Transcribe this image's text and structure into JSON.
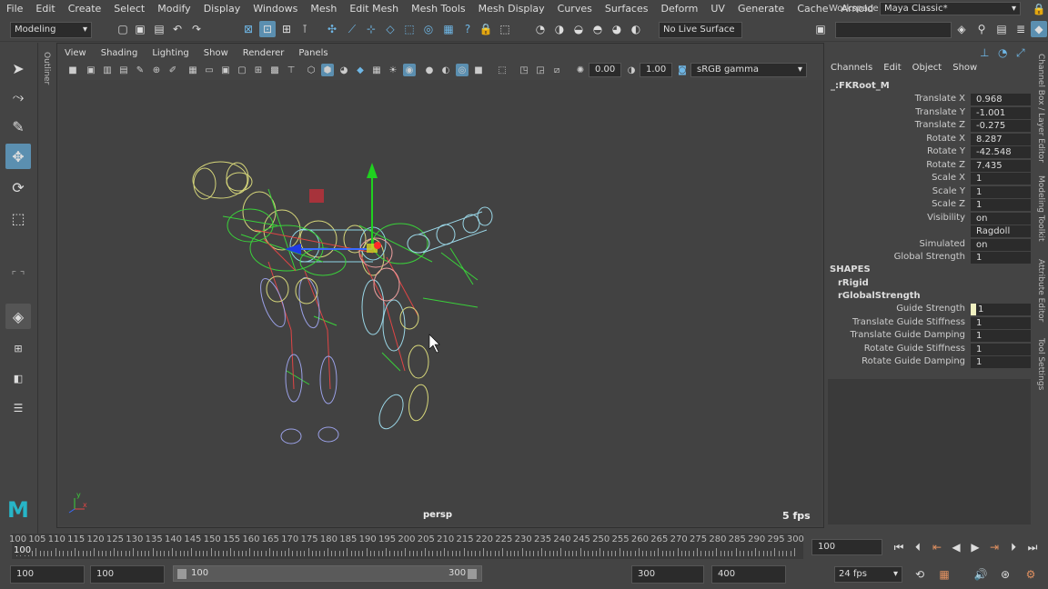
{
  "menu": [
    "File",
    "Edit",
    "Create",
    "Select",
    "Modify",
    "Display",
    "Windows",
    "Mesh",
    "Edit Mesh",
    "Mesh Tools",
    "Mesh Display",
    "Curves",
    "Surfaces",
    "Deform",
    "UV",
    "Generate",
    "Cache",
    "Arnold",
    "Ragdoll"
  ],
  "workspace": {
    "label": "Workspace :",
    "value": "Maya Classic*"
  },
  "shelf": {
    "mode": "Modeling",
    "live_surface": "No Live Surface"
  },
  "outliner_tab": "Outliner",
  "panel_menu": [
    "View",
    "Shading",
    "Lighting",
    "Show",
    "Renderer",
    "Panels"
  ],
  "panel_toolbar": {
    "exposure": "0.00",
    "gamma": "1.00",
    "color_space": "sRGB gamma"
  },
  "viewport": {
    "camera": "persp",
    "fps": "5 fps",
    "axis_x": "x",
    "axis_y": "y"
  },
  "channelbox": {
    "menu": [
      "Channels",
      "Edit",
      "Object",
      "Show"
    ],
    "node": "_:FKRoot_M",
    "attributes": [
      {
        "label": "Translate X",
        "value": "0.968"
      },
      {
        "label": "Translate Y",
        "value": "-1.001"
      },
      {
        "label": "Translate Z",
        "value": "-0.275"
      },
      {
        "label": "Rotate X",
        "value": "8.287"
      },
      {
        "label": "Rotate Y",
        "value": "-42.548"
      },
      {
        "label": "Rotate Z",
        "value": "7.435"
      },
      {
        "label": "Scale X",
        "value": "1"
      },
      {
        "label": "Scale Y",
        "value": "1"
      },
      {
        "label": "Scale Z",
        "value": "1"
      },
      {
        "label": "Visibility",
        "value": "on"
      },
      {
        "label": "",
        "value": "Ragdoll"
      },
      {
        "label": "Simulated",
        "value": "on"
      },
      {
        "label": "Global Strength",
        "value": "1"
      }
    ],
    "shapes_header": "SHAPES",
    "shape1": "rRigid",
    "shape2": "rGlobalStrength",
    "shape_attributes": [
      {
        "label": "Guide Strength",
        "value": "1"
      },
      {
        "label": "Translate Guide Stiffness",
        "value": "1"
      },
      {
        "label": "Translate Guide Damping",
        "value": "1"
      },
      {
        "label": "Rotate Guide Stiffness",
        "value": "1"
      },
      {
        "label": "Rotate Guide Damping",
        "value": "1"
      }
    ]
  },
  "side_tabs": [
    "Channel Box / Layer Editor",
    "Modeling Toolkit",
    "Attribute Editor",
    "Tool Settings"
  ],
  "timeline": {
    "ticks": [
      "100",
      "105",
      "110",
      "115",
      "120",
      "125",
      "130",
      "135",
      "140",
      "145",
      "150",
      "155",
      "160",
      "165",
      "170",
      "175",
      "180",
      "185",
      "190",
      "195",
      "200",
      "205",
      "210",
      "215",
      "220",
      "225",
      "230",
      "235",
      "240",
      "245",
      "250",
      "255",
      "260",
      "265",
      "270",
      "275",
      "280",
      "285",
      "290",
      "295",
      "300"
    ],
    "current": "100",
    "current_frame_box": "100"
  },
  "range": {
    "start": "100",
    "playback_start": "100",
    "slider_start": "100",
    "slider_end": "300",
    "playback_end": "300",
    "end": "400",
    "fps": "24 fps"
  }
}
